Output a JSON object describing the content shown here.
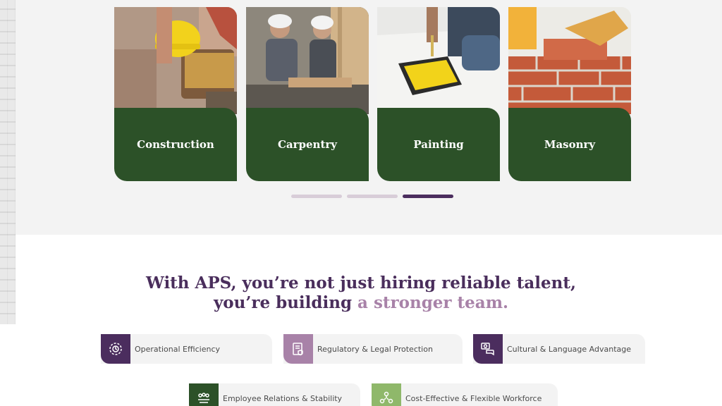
{
  "services": [
    {
      "label": "Construction"
    },
    {
      "label": "Carpentry"
    },
    {
      "label": "Painting"
    },
    {
      "label": "Masonry"
    }
  ],
  "pager": {
    "count": 3,
    "active_index": 2
  },
  "headline": {
    "line1": "With APS, you’re not just hiring reliable talent,",
    "line2_prefix": "you’re building ",
    "line2_accent": "a stronger team."
  },
  "benefits": [
    {
      "label": "Operational Efficiency",
      "icon": "efficiency-gear-icon",
      "color": "#4b2d5e"
    },
    {
      "label": "Regulatory & Legal Protection",
      "icon": "legal-document-icon",
      "color": "#a882a8"
    },
    {
      "label": "Cultural & Language Advantage",
      "icon": "language-chat-icon",
      "color": "#4b2d5e"
    },
    {
      "label": "Employee Relations & Stability",
      "icon": "team-people-icon",
      "color": "#2c5128"
    },
    {
      "label": "Cost-Effective & Flexible Workforce",
      "icon": "cost-flex-icon",
      "color": "#8fb86a"
    }
  ],
  "colors": {
    "brand_green": "#2c5128",
    "brand_purple": "#4a2e5c",
    "accent_lilac": "#a882a8"
  }
}
